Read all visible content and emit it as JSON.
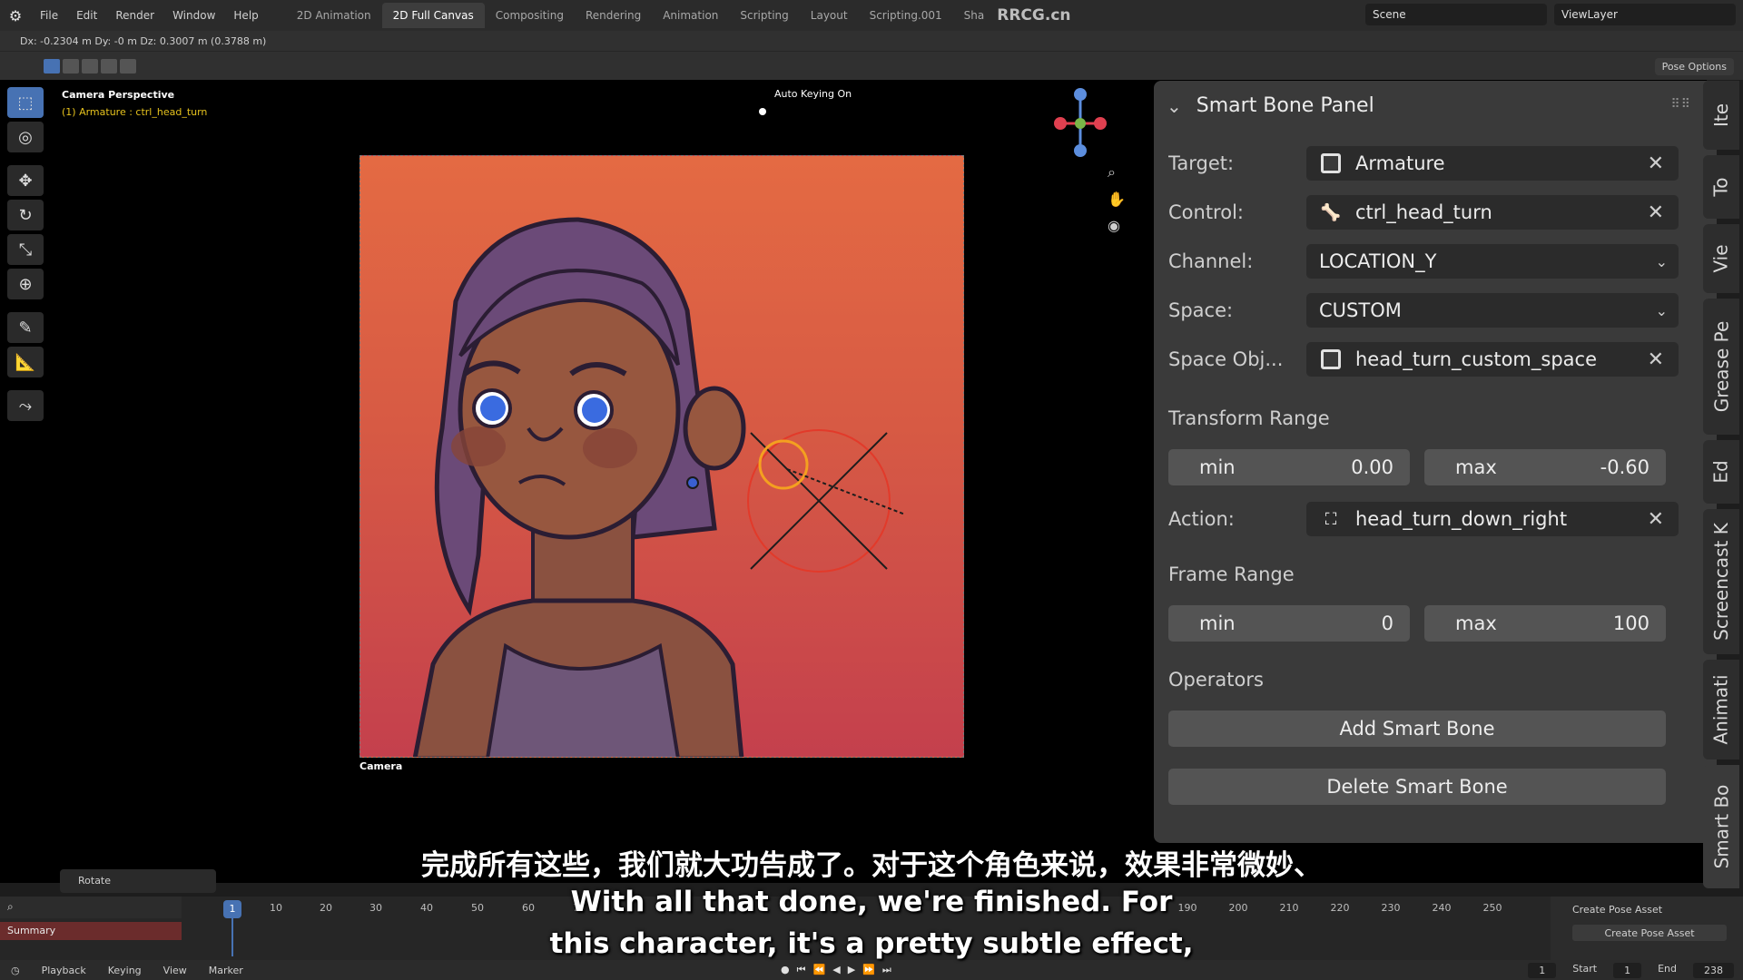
{
  "menubar": {
    "app_icon": "blender-logo-icon",
    "menus": [
      "File",
      "Edit",
      "Render",
      "Window",
      "Help"
    ],
    "workspaces": [
      "2D Animation",
      "2D Full Canvas",
      "Compositing",
      "Rendering",
      "Animation",
      "Scripting",
      "Layout",
      "Scripting.001",
      "Sha"
    ],
    "active_workspace": "2D Full Canvas",
    "watermark": "RRCG.cn",
    "scene": "Scene",
    "view_layer": "ViewLayer"
  },
  "infobar": {
    "text": "Dx: -0.2304 m   Dy: -0 m   Dz: 0.3007 m (0.3788 m)"
  },
  "toolheader": {
    "pose_options": "Pose Options"
  },
  "viewport": {
    "title": "Camera Perspective",
    "object": "(1) Armature : ctrl_head_turn",
    "auto_keying": "Auto Keying On",
    "camera_label": "Camera"
  },
  "panel": {
    "title": "Smart Bone Panel",
    "target": {
      "label": "Target:",
      "value": "Armature"
    },
    "control": {
      "label": "Control:",
      "value": "ctrl_head_turn"
    },
    "channel": {
      "label": "Channel:",
      "value": "LOCATION_Y"
    },
    "space": {
      "label": "Space:",
      "value": "CUSTOM"
    },
    "space_obj": {
      "label": "Space Obj...",
      "value": "head_turn_custom_space"
    },
    "transform_range": {
      "label": "Transform Range",
      "min_label": "min",
      "min": "0.00",
      "max_label": "max",
      "max": "-0.60"
    },
    "action": {
      "label": "Action:",
      "value": "head_turn_down_right"
    },
    "frame_range": {
      "label": "Frame Range",
      "min_label": "min",
      "min": "0",
      "max_label": "max",
      "max": "100"
    },
    "operators": {
      "label": "Operators",
      "add": "Add Smart Bone",
      "delete": "Delete Smart Bone"
    }
  },
  "side_tabs": [
    "Ite",
    "To",
    "Vie",
    "Grease Pe",
    "Ed",
    "Screencast K",
    "Animati",
    "Smart Bo"
  ],
  "timeline": {
    "rotate_label": "Rotate",
    "summary": "Summary",
    "current_frame_badge": "1",
    "ticks": [
      "10",
      "20",
      "30",
      "40",
      "50",
      "60",
      "70",
      "190",
      "200",
      "210",
      "220",
      "230",
      "240",
      "250"
    ],
    "pose_asset_header": "Create Pose Asset",
    "pose_asset_button": "Create Pose Asset"
  },
  "footer": {
    "menus": [
      "Playback",
      "Keying",
      "View",
      "Marker"
    ],
    "current_frame": "1",
    "start_label": "Start",
    "start": "1",
    "end_label": "End",
    "end": "238"
  },
  "subtitles": {
    "cn": "完成所有这些，我们就大功告成了。对于这个角色来说，效果非常微妙、",
    "en1": "With all that done, we're finished. For",
    "en2": "this character, it's a pretty subtle effect,"
  }
}
